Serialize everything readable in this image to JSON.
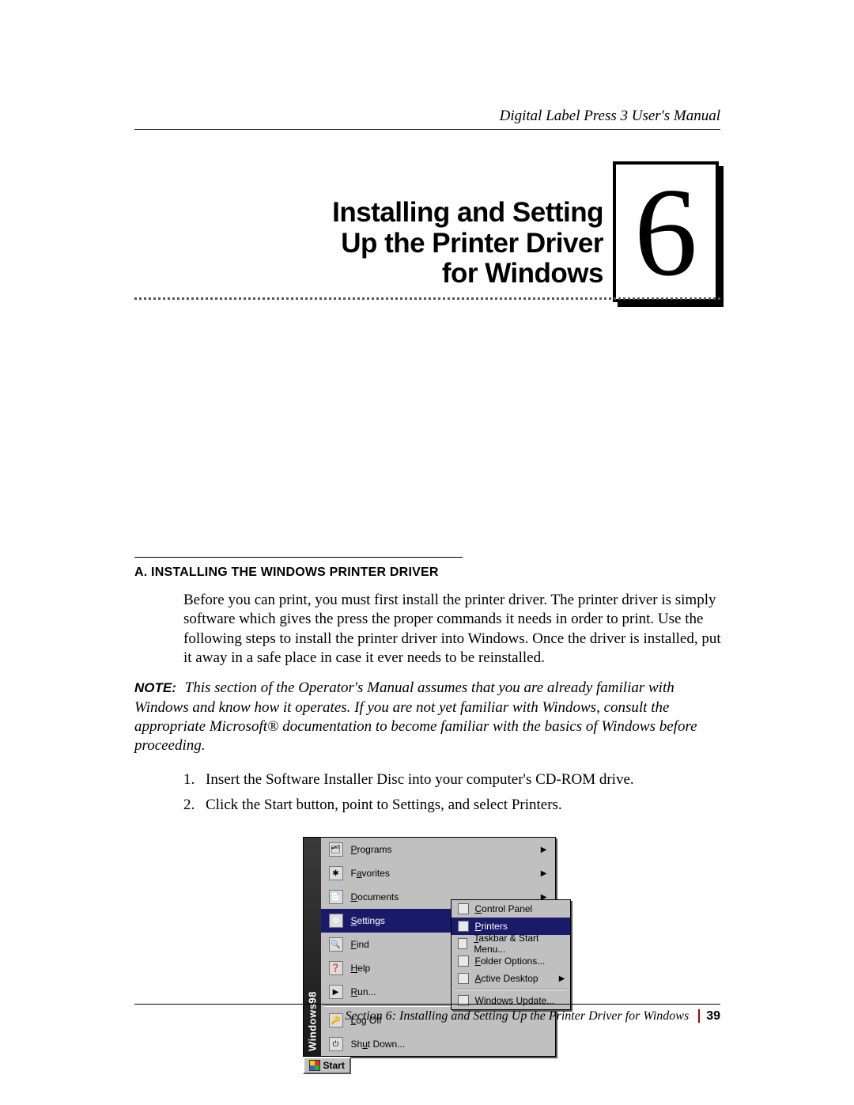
{
  "running_head": "Digital Label Press 3 User's Manual",
  "chapter": {
    "number": "6",
    "title_line1": "Installing and Setting",
    "title_line2": "Up the Printer Driver",
    "title_line3": "for Windows"
  },
  "section": {
    "heading": "A. INSTALLING THE WINDOWS PRINTER DRIVER",
    "intro": "Before you can print, you must first install the printer driver. The printer driver is simply software which gives the press the proper commands it needs in order to print. Use the following steps to install the printer driver into Windows. Once the driver is installed, put it away in a safe place in case it ever needs to be reinstalled."
  },
  "note": {
    "label": "NOTE:",
    "text": "This section of the Operator's Manual assumes that you are already familiar with Windows and know how it operates. If you are not yet familiar with Windows, consult the appropriate Microsoft® documentation to become familiar with the basics of Windows before proceeding."
  },
  "steps": [
    {
      "n": "1.",
      "text": "Insert the Software Installer Disc into your computer's CD-ROM drive."
    },
    {
      "n": "2.",
      "text": "Click the Start button, point to Settings, and select Printers."
    }
  ],
  "startmenu": {
    "side_label": "Windows98",
    "items": [
      {
        "label": "Programs",
        "arrow": true
      },
      {
        "label": "Favorites",
        "arrow": true
      },
      {
        "label": "Documents",
        "arrow": true
      },
      {
        "label": "Settings",
        "arrow": true,
        "selected": true
      },
      {
        "label": "Find",
        "arrow": true
      },
      {
        "label": "Help",
        "arrow": false
      },
      {
        "label": "Run...",
        "arrow": false
      },
      {
        "label": "Log Off",
        "arrow": false
      },
      {
        "label": "Shut Down...",
        "arrow": false
      }
    ],
    "submenu": [
      {
        "label": "Control Panel"
      },
      {
        "label": "Printers",
        "selected": true
      },
      {
        "label": "Taskbar & Start Menu..."
      },
      {
        "label": "Folder Options..."
      },
      {
        "label": "Active Desktop",
        "arrow": true
      },
      {
        "label": "Windows Update..."
      }
    ],
    "start_button": "Start"
  },
  "footer": {
    "text": "Section 6:  Installing and Setting Up the Printer Driver for Windows",
    "page": "39"
  }
}
